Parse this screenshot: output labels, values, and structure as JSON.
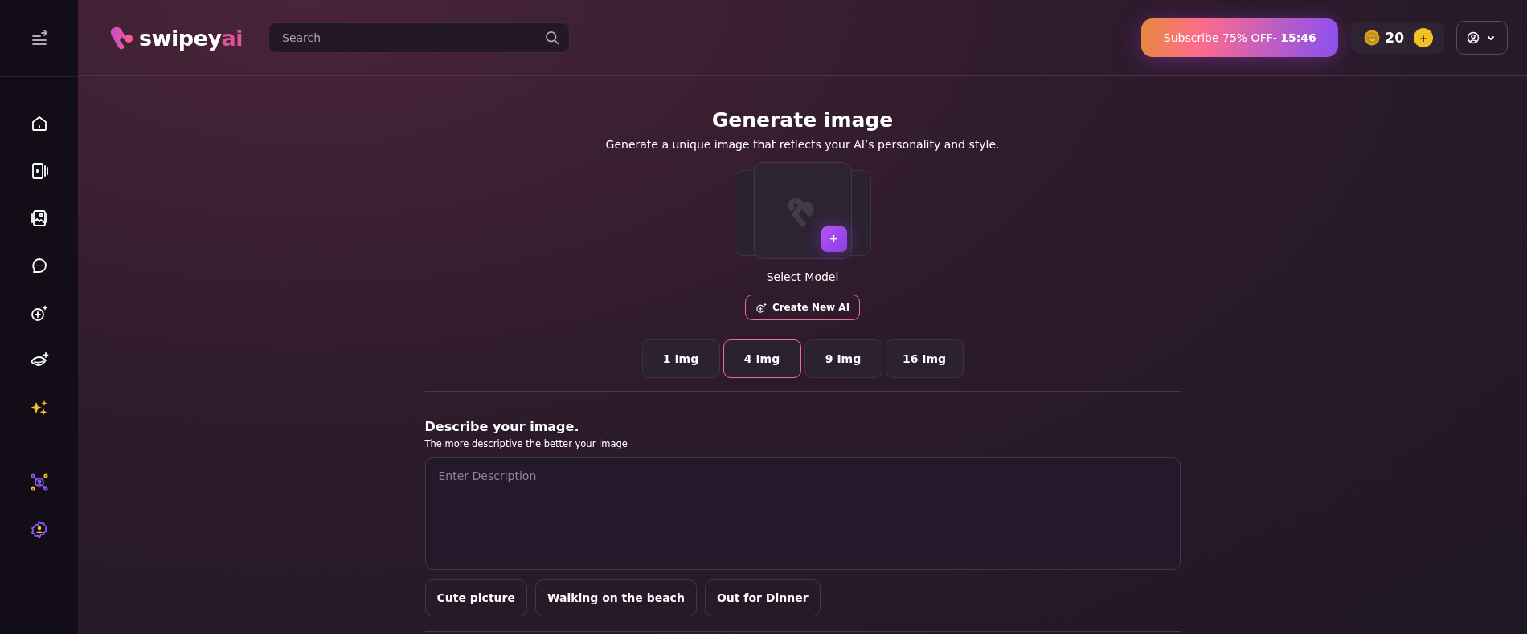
{
  "logo": {
    "text": "swipey",
    "accent": "ai"
  },
  "search": {
    "placeholder": "Search"
  },
  "subscribe": {
    "label": "Subscribe 75% OFF- **15:46**"
  },
  "coins": {
    "count": "20",
    "add": "+"
  },
  "sidebar": {
    "items": [
      {
        "kind": "home"
      },
      {
        "kind": "video"
      },
      {
        "kind": "gallery"
      },
      {
        "kind": "chat"
      },
      {
        "kind": "create"
      },
      {
        "kind": "lips"
      },
      {
        "kind": "sparkle"
      }
    ],
    "bottom_items": [
      {
        "kind": "network"
      },
      {
        "kind": "settings"
      }
    ]
  },
  "title": "Generate image",
  "subtitle": "Generate a unique image that reflects your AI’s personality and style.",
  "model": {
    "label": "Select Model",
    "add": "+"
  },
  "create_button": "Create New AI",
  "counts": [
    {
      "label": "1 Img",
      "selected": false
    },
    {
      "label": "4 Img",
      "selected": true
    },
    {
      "label": "9 Img",
      "selected": false
    },
    {
      "label": "16 Img",
      "selected": false
    }
  ],
  "describe": {
    "heading": "Describe your image.",
    "hint": "The more descriptive the better your image",
    "placeholder": "Enter Description"
  },
  "suggestions": [
    "Cute picture",
    "Walking on the beach",
    "Out for Dinner"
  ]
}
